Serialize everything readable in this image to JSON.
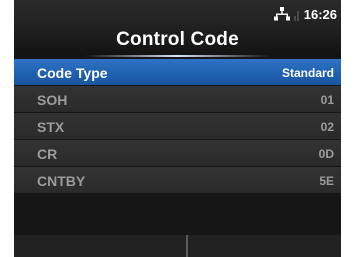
{
  "header": {
    "title": "Control Code",
    "time": "16:26"
  },
  "icons": {
    "network": "network-icon",
    "signal": "signal-strength-icon"
  },
  "colors": {
    "selected_row": "#2166b8",
    "row_background": "#2f2f2f",
    "panel_background": "#161616",
    "inactive_text": "#9c9c9c",
    "active_text": "#ffffff"
  },
  "list": {
    "items": [
      {
        "label": "Code Type",
        "value": "Standard",
        "selected": true
      },
      {
        "label": "SOH",
        "value": "01"
      },
      {
        "label": "STX",
        "value": "02"
      },
      {
        "label": "CR",
        "value": "0D"
      },
      {
        "label": "CNTBY",
        "value": "5E"
      }
    ]
  },
  "softkeys": {
    "left_label": "",
    "right_label": ""
  }
}
